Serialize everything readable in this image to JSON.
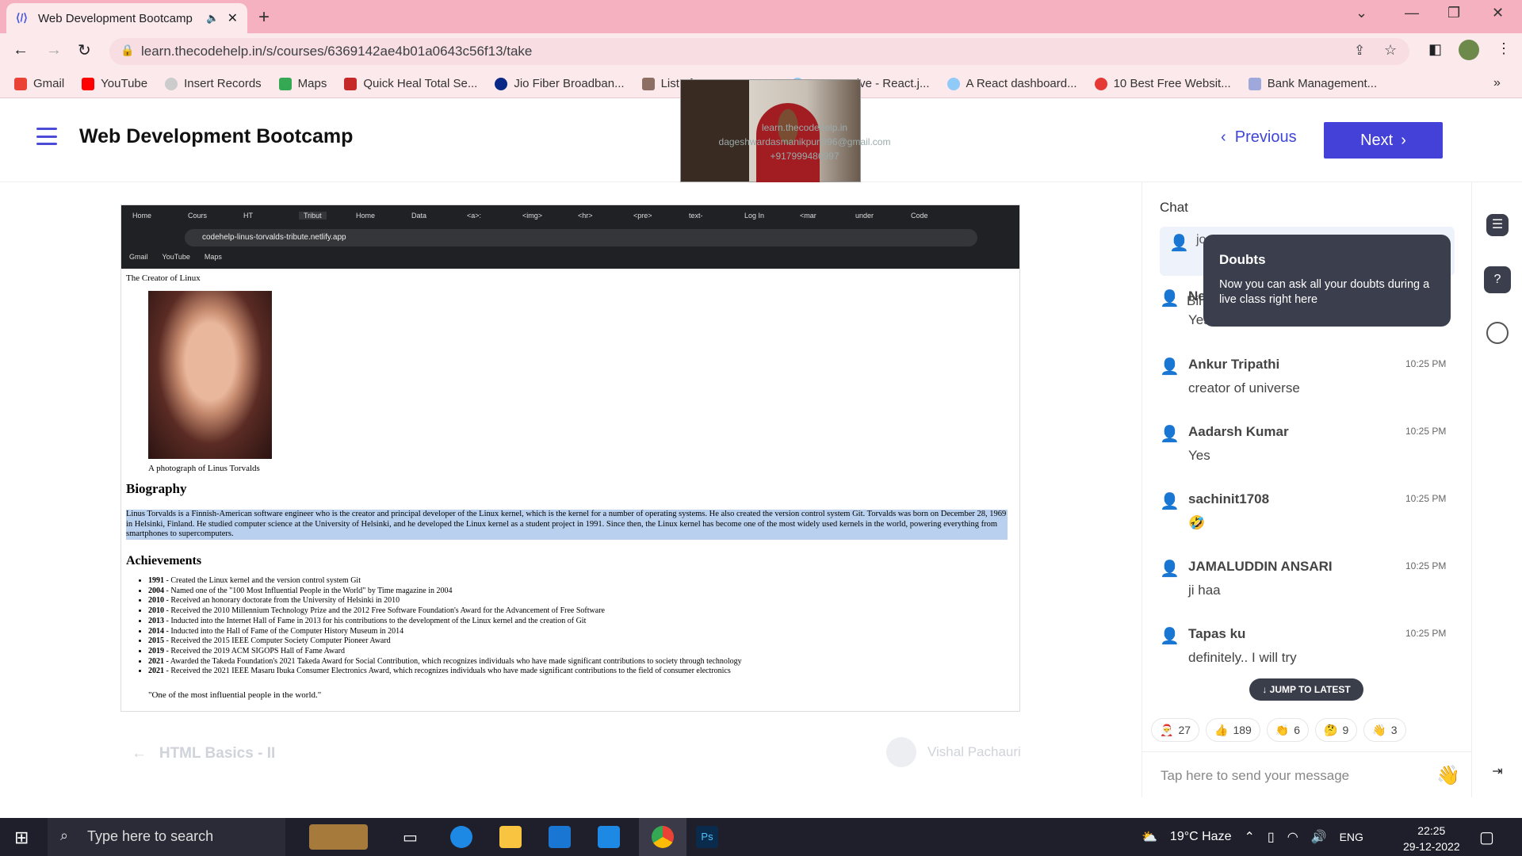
{
  "browser": {
    "tab_title": "Web Development Bootcamp",
    "url": "learn.thecodehelp.in/s/courses/6369142ae4b01a0643c56f13/take"
  },
  "bookmarks": [
    "Gmail",
    "YouTube",
    "Insert Records",
    "Maps",
    "Quick Heal Total Se...",
    "Jio Fiber Broadban...",
    "List of Top IT Comp...",
    "Responsive - React.j...",
    "A React dashboard...",
    "10 Best Free Websit...",
    "Bank Management..."
  ],
  "header": {
    "course_title": "Web Development Bootcamp",
    "prev_label": "Previous",
    "next_label": "Next"
  },
  "embedded": {
    "tabs": [
      "Home",
      "Cours",
      "HT",
      "Tribut",
      "Home",
      "Data",
      "<a>:",
      "<img>",
      "<hr>",
      "<pre>",
      "text-",
      "Log In",
      "<mar",
      "under",
      "Code"
    ],
    "url": "codehelp-linus-torvalds-tribute.netlify.app",
    "bookmarks": [
      "Gmail",
      "YouTube",
      "Maps"
    ],
    "creator_text": "The Creator of Linux",
    "photo_caption": "A photograph of Linus Torvalds",
    "bio_heading": "Biography",
    "bio_text": "Linus Torvalds is a Finnish-American software engineer who is the creator and principal developer of the Linux kernel, which is the kernel for a number of operating systems. He also created the version control system Git. Torvalds was born on December 28, 1969 in Helsinki, Finland. He studied computer science at the University of Helsinki, and he developed the Linux kernel as a student project in 1991. Since then, the Linux kernel has become one of the most widely used kernels in the world, powering everything from smartphones to supercomputers.",
    "ach_heading": "Achievements",
    "achievements": [
      [
        "1991",
        " - Created the Linux kernel and the version control system Git"
      ],
      [
        "2004",
        " - Named one of the \"100 Most Influential People in the World\" by Time magazine in 2004"
      ],
      [
        "2010",
        " - Received an honorary doctorate from the University of Helsinki in 2010"
      ],
      [
        "2010",
        " - Received the 2010 Millennium Technology Prize and the 2012 Free Software Foundation's Award for the Advancement of Free Software"
      ],
      [
        "2013",
        " - Inducted into the Internet Hall of Fame in 2013 for his contributions to the development of the Linux kernel and the creation of Git"
      ],
      [
        "2014",
        " - Inducted into the Hall of Fame of the Computer History Museum in 2014"
      ],
      [
        "2015",
        " - Received the 2015 IEEE Computer Society Computer Pioneer Award"
      ],
      [
        "2019",
        " - Received the 2019 ACM SIGOPS Hall of Fame Award"
      ],
      [
        "2021",
        " - Awarded the Takeda Foundation's 2021 Takeda Award for Social Contribution, which recognizes individuals who have made significant contributions to society through technology"
      ],
      [
        "2021",
        " - Received the 2021 IEEE Masaru Ibuka Consumer Electronics Award, which recognizes individuals who have made significant contributions to the field of consumer electronics"
      ]
    ],
    "quote": "\"One of the most influential people in the world.\"",
    "watermark": [
      "learn.thecodehelp.in",
      "dageshwardasmanikpuri996@gmail.com",
      "+917999486997"
    ]
  },
  "footer_nav": {
    "prev_lesson": "HTML Basics - II",
    "author": "Vishal Pachauri"
  },
  "chat": {
    "heading": "Chat",
    "pinned_preview": "jo",
    "partial_top": "Bil",
    "messages": [
      {
        "name": "Neeraj Hariyale",
        "time": "10:25 PM",
        "text": "Yes"
      },
      {
        "name": "Ankur Tripathi",
        "time": "10:25 PM",
        "text": "creator of universe"
      },
      {
        "name": "Aadarsh Kumar",
        "time": "10:25 PM",
        "text": "Yes"
      },
      {
        "name": "sachinit1708",
        "time": "10:25 PM",
        "text": "🤣"
      },
      {
        "name": "JAMALUDDIN ANSARI",
        "time": "10:25 PM",
        "text": "ji haa"
      },
      {
        "name": "Tapas ku",
        "time": "10:25 PM",
        "text": "definitely.. I will try"
      }
    ],
    "jump_label": "↓ JUMP TO LATEST",
    "reactions": [
      {
        "icon": "🎅",
        "count": "27"
      },
      {
        "icon": "👍",
        "count": "189"
      },
      {
        "icon": "👏",
        "count": "6"
      },
      {
        "icon": "🤔",
        "count": "9"
      },
      {
        "icon": "👋",
        "count": "3"
      }
    ],
    "input_placeholder": "Tap here to send your message"
  },
  "tooltip": {
    "title": "Doubts",
    "body": "Now you can ask all your doubts during a live class right here"
  },
  "taskbar": {
    "search_placeholder": "Type here to search",
    "weather": "19°C  Haze",
    "lang": "ENG",
    "time": "22:25",
    "date": "29-12-2022"
  }
}
